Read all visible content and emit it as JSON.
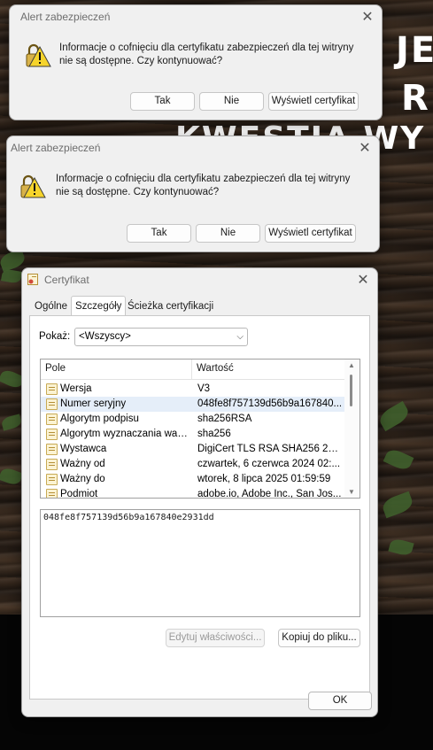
{
  "background": {
    "headline_1": "JE",
    "headline_2": "R",
    "headline_3": "KWESTIA WY"
  },
  "alert_1": {
    "title": "Alert zabezpieczeń",
    "message": "Informacje o cofnięciu dla certyfikatu zabezpieczeń dla tej witryny nie są dostępne. Czy kontynuować?",
    "buttons": {
      "yes": "Tak",
      "no": "Nie",
      "view": "Wyświetl certyfikat"
    }
  },
  "alert_2": {
    "title": "Alert zabezpieczeń",
    "message": "Informacje o cofnięciu dla certyfikatu zabezpieczeń dla tej witryny nie są dostępne. Czy kontynuować?",
    "buttons": {
      "yes": "Tak",
      "no": "Nie",
      "view": "Wyświetl certyfikat"
    }
  },
  "certificate": {
    "title": "Certyfikat",
    "tabs": [
      "Ogólne",
      "Szczegóły",
      "Ścieżka certyfikacji"
    ],
    "active_tab": "Szczegóły",
    "show_label": "Pokaż:",
    "show_value": "<Wszyscy>",
    "columns": {
      "field": "Pole",
      "value": "Wartość"
    },
    "rows": [
      {
        "field": "Wersja",
        "value": "V3"
      },
      {
        "field": "Numer seryjny",
        "value": "048fe8f757139d56b9a167840..."
      },
      {
        "field": "Algorytm podpisu",
        "value": "sha256RSA"
      },
      {
        "field": "Algorytm wyznaczania wart...",
        "value": "sha256"
      },
      {
        "field": "Wystawca",
        "value": "DigiCert TLS RSA SHA256 202..."
      },
      {
        "field": "Ważny od",
        "value": "czwartek, 6 czerwca 2024 02:..."
      },
      {
        "field": "Ważny do",
        "value": "wtorek, 8 lipca 2025 01:59:59"
      },
      {
        "field": "Podmiot",
        "value": "adobe.io, Adobe Inc., San Jos..."
      }
    ],
    "selected_row": "Numer seryjny",
    "detail_value": "048fe8f757139d56b9a167840e2931dd",
    "buttons": {
      "edit_properties": "Edytuj właściwości...",
      "copy_to_file": "Kopiuj do pliku...",
      "ok": "OK"
    }
  }
}
